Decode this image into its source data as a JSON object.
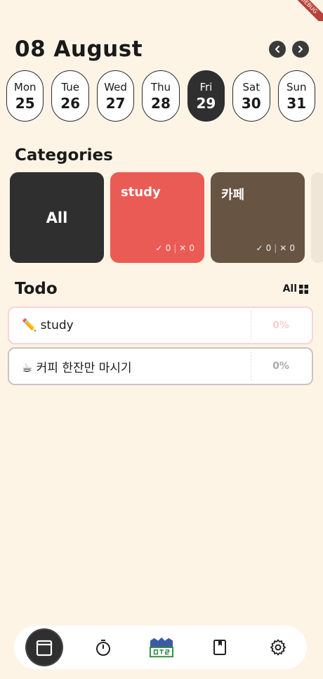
{
  "debug_banner": "DEBUG",
  "header": {
    "title": "08 August",
    "prev_icon": "chevron-left-icon",
    "next_icon": "chevron-right-icon"
  },
  "week": [
    {
      "name": "Mon",
      "num": "25",
      "selected": false
    },
    {
      "name": "Tue",
      "num": "26",
      "selected": false
    },
    {
      "name": "Wed",
      "num": "27",
      "selected": false
    },
    {
      "name": "Thu",
      "num": "28",
      "selected": false
    },
    {
      "name": "Fri",
      "num": "29",
      "selected": true
    },
    {
      "name": "Sat",
      "num": "30",
      "selected": false
    },
    {
      "name": "Sun",
      "num": "31",
      "selected": false
    }
  ],
  "categories": {
    "title": "Categories",
    "items": [
      {
        "name": "All",
        "color": "#2f2f2f"
      },
      {
        "name": "study",
        "done": "0",
        "failed": "0",
        "color": "#eb5b55"
      },
      {
        "name": "카페",
        "done": "0",
        "failed": "0",
        "color": "#685443"
      }
    ]
  },
  "todo": {
    "title": "Todo",
    "filter_label": "All",
    "filter_icon": "grid-icon",
    "items": [
      {
        "text": "✏️ study",
        "percent": "0%",
        "border_color": "#f7d4d3"
      },
      {
        "text": "☕ 커피 한잔만 마시기",
        "percent": "0%",
        "border_color": "#c8c4c0"
      }
    ]
  },
  "bottom_nav": {
    "items": [
      {
        "icon": "calendar-icon",
        "active": true
      },
      {
        "icon": "timer-icon",
        "active": false
      },
      {
        "icon": "app-logo-icon",
        "active": false
      },
      {
        "icon": "bookmark-book-icon",
        "active": false
      },
      {
        "icon": "gear-icon",
        "active": false
      }
    ]
  },
  "colors": {
    "background": "#fdf4e6",
    "dark": "#2f2f2f",
    "accent_red": "#eb5b55",
    "accent_brown": "#685443"
  }
}
